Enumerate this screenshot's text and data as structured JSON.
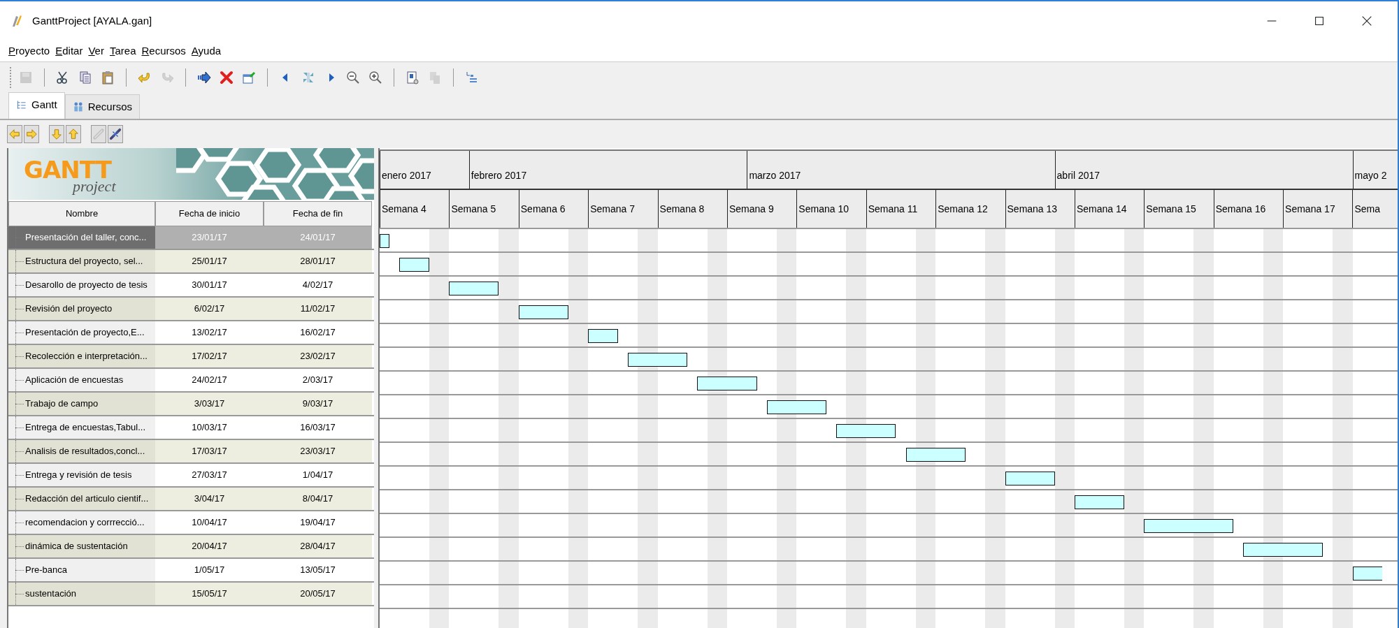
{
  "window": {
    "title": "GanttProject [AYALA.gan]"
  },
  "menu": [
    {
      "label": "Proyecto"
    },
    {
      "label": "Editar"
    },
    {
      "label": "Ver"
    },
    {
      "label": "Tarea"
    },
    {
      "label": "Recursos"
    },
    {
      "label": "Ayuda"
    }
  ],
  "toolbar": [
    [
      {
        "kind": "save",
        "disabled": true
      }
    ],
    [
      {
        "kind": "cut",
        "disabled": false
      },
      {
        "kind": "copy",
        "disabled": false
      },
      {
        "kind": "paste",
        "disabled": false
      }
    ],
    [
      {
        "kind": "undo",
        "disabled": false
      },
      {
        "kind": "redo",
        "disabled": true
      }
    ],
    [
      {
        "kind": "indent",
        "disabled": false
      },
      {
        "kind": "delete",
        "disabled": false
      },
      {
        "kind": "properties",
        "disabled": false
      }
    ],
    [
      {
        "kind": "scroll-left",
        "disabled": false
      },
      {
        "kind": "fit",
        "disabled": false
      },
      {
        "kind": "scroll-right",
        "disabled": false
      },
      {
        "kind": "zoom-out",
        "disabled": false
      },
      {
        "kind": "zoom-in",
        "disabled": false
      }
    ],
    [
      {
        "kind": "report",
        "disabled": false
      },
      {
        "kind": "pages",
        "disabled": true
      }
    ],
    [
      {
        "kind": "chart-options",
        "disabled": false
      }
    ]
  ],
  "tabs": [
    {
      "label": "Gantt",
      "kind": "gantt",
      "selected": true
    },
    {
      "label": "Recursos",
      "kind": "resources",
      "selected": false
    }
  ],
  "task_toolbar": [
    [
      {
        "kind": "left",
        "disabled": false
      },
      {
        "kind": "right",
        "disabled": false
      }
    ],
    [
      {
        "kind": "down",
        "disabled": false
      },
      {
        "kind": "up",
        "disabled": false
      }
    ],
    [
      {
        "kind": "link",
        "disabled": true
      },
      {
        "kind": "unlink",
        "disabled": false
      }
    ]
  ],
  "logo": {
    "wordmark": "GANTT",
    "tagline": "project"
  },
  "table": {
    "columns": [
      "Nombre",
      "Fecha de inicio",
      "Fecha de fin"
    ],
    "rows": [
      {
        "name": "Presentación del taller, conc...",
        "start": "23/01/17",
        "end": "24/01/17",
        "selected": true
      },
      {
        "name": "Estructura del proyecto, sel...",
        "start": "25/01/17",
        "end": "28/01/17",
        "selected": false
      },
      {
        "name": "Desarollo de proyecto de tesis",
        "start": "30/01/17",
        "end": "4/02/17",
        "selected": false
      },
      {
        "name": "Revisión del proyecto",
        "start": "6/02/17",
        "end": "11/02/17",
        "selected": false
      },
      {
        "name": "Presentación de proyecto,E...",
        "start": "13/02/17",
        "end": "16/02/17",
        "selected": false
      },
      {
        "name": "Recolección e interpretación...",
        "start": "17/02/17",
        "end": "23/02/17",
        "selected": false
      },
      {
        "name": "Aplicación de encuestas",
        "start": "24/02/17",
        "end": "2/03/17",
        "selected": false
      },
      {
        "name": "Trabajo de campo",
        "start": "3/03/17",
        "end": "9/03/17",
        "selected": false
      },
      {
        "name": "Entrega de encuestas,Tabul...",
        "start": "10/03/17",
        "end": "16/03/17",
        "selected": false
      },
      {
        "name": "Analisis de resultados,concl...",
        "start": "17/03/17",
        "end": "23/03/17",
        "selected": false
      },
      {
        "name": "Entrega y revisión de tesis",
        "start": "27/03/17",
        "end": "1/04/17",
        "selected": false
      },
      {
        "name": "Redacción del articulo cientif...",
        "start": "3/04/17",
        "end": "8/04/17",
        "selected": false
      },
      {
        "name": "recomendacion y corrrecció...",
        "start": "10/04/17",
        "end": "19/04/17",
        "selected": false
      },
      {
        "name": "dinámica de sustentación",
        "start": "20/04/17",
        "end": "28/04/17",
        "selected": false
      },
      {
        "name": "Pre-banca",
        "start": "1/05/17",
        "end": "13/05/17",
        "selected": false
      },
      {
        "name": "sustentación",
        "start": "15/05/17",
        "end": "20/05/17",
        "selected": false
      }
    ]
  },
  "timeline": {
    "months": [
      "enero 2017",
      "febrero 2017",
      "marzo 2017",
      "abril 2017",
      "mayo 2"
    ],
    "weeks": [
      "Semana 4",
      "Semana 5",
      "Semana 6",
      "Semana 7",
      "Semana 8",
      "Semana 9",
      "Semana 10",
      "Semana 11",
      "Semana 12",
      "Semana 13",
      "Semana 14",
      "Semana 15",
      "Semana 16",
      "Semana 17",
      "Sema"
    ]
  }
}
